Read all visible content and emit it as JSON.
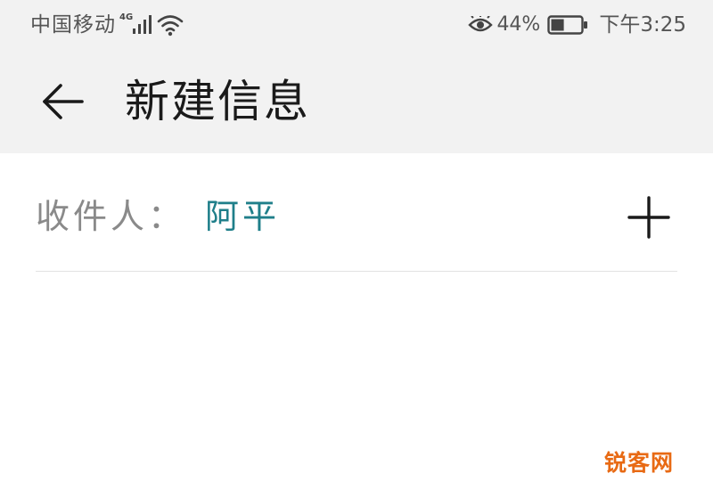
{
  "status_bar": {
    "carrier": "中国移动",
    "network_type": "4G",
    "signal_icon": "signal-bars-icon",
    "wifi_icon": "wifi-icon",
    "eye_icon": "eye-comfort-icon",
    "battery_percent": "44%",
    "battery_level": 0.44,
    "time": "下午3:25"
  },
  "app_bar": {
    "back_icon": "back-arrow-icon",
    "title": "新建信息"
  },
  "recipient": {
    "label": "收件人：",
    "value": "阿平",
    "add_icon": "plus-icon"
  },
  "watermark": {
    "text": "锐客网"
  },
  "colors": {
    "recipient_accent": "#1f7f8a",
    "bar_background": "#f2f2f2",
    "watermark": "#e86a14"
  }
}
